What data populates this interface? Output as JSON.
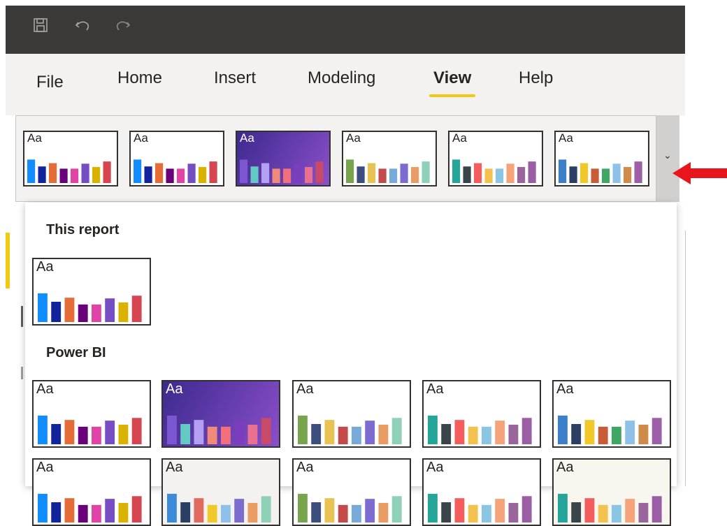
{
  "quick_access": {
    "save_icon": "save-icon",
    "undo_icon": "undo-icon",
    "redo_icon": "redo-icon"
  },
  "tabs": [
    {
      "label": "File",
      "active": false
    },
    {
      "label": "Home",
      "active": false
    },
    {
      "label": "Insert",
      "active": false
    },
    {
      "label": "Modeling",
      "active": false
    },
    {
      "label": "View",
      "active": true
    },
    {
      "label": "Help",
      "active": false
    }
  ],
  "theme_sample_text": "Aa",
  "sections": {
    "this_report": "This report",
    "power_bi": "Power BI"
  },
  "themes": {
    "default": {
      "bg": "#ffffff",
      "bg2": "#ffffff",
      "text": "#252423",
      "bars": [
        "#118dff",
        "#12239e",
        "#e66c37",
        "#6b007b",
        "#e044a7",
        "#744ec2",
        "#d9b300",
        "#d64550"
      ]
    },
    "violet": {
      "bg": "#3c2a8e",
      "bg2": "#8b4fc9",
      "text": "#ffffff",
      "bars": [
        "#7d56d2",
        "#62c9c3",
        "#b3a0f2",
        "#f08a7a",
        "#f2707e",
        "#7a3dbd",
        "#e9708e",
        "#c84a6a"
      ]
    },
    "frontier": {
      "bg": "#ffffff",
      "bg2": "#ffffff",
      "text": "#252423",
      "bars": [
        "#79a44e",
        "#3c4e7d",
        "#e8c354",
        "#c44b4b",
        "#76abd9",
        "#7d6cd0",
        "#e99d64",
        "#8fd0b9"
      ]
    },
    "highrise": {
      "bg": "#ffffff",
      "bg2": "#ffffff",
      "text": "#252423",
      "bars": [
        "#25a49a",
        "#394548",
        "#f45d5d",
        "#f2c14e",
        "#8bc5e4",
        "#f5a37b",
        "#99659c",
        "#9b5ea5"
      ]
    },
    "executive": {
      "bg": "#ffffff",
      "bg2": "#ffffff",
      "text": "#252423",
      "bars": [
        "#3b7fc9",
        "#2b3e63",
        "#f0c82a",
        "#c75c36",
        "#3fa763",
        "#8fc0e8",
        "#d08a4a",
        "#9c5fa8"
      ]
    },
    "tidal": {
      "bg": "#f3f2f1",
      "bg2": "#f3f2f1",
      "text": "#252423",
      "bars": [
        "#3c8bd9",
        "#2b3e63",
        "#e06a5e",
        "#f0c82a",
        "#8fc0e8",
        "#7d6cd0",
        "#e99d64",
        "#8fd0b9"
      ]
    },
    "sunset": {
      "bg": "#f7f6ef",
      "bg2": "#f7f6ef",
      "text": "#252423",
      "bars": [
        "#25a49a",
        "#394548",
        "#f45d5d",
        "#f2c14e",
        "#8bc5e4",
        "#f5a37b",
        "#99659c",
        "#9b5ea5"
      ]
    }
  },
  "strip_themes": [
    "default",
    "default",
    "violet",
    "frontier",
    "highrise",
    "executive"
  ],
  "this_report_themes": [
    "default"
  ],
  "power_bi_themes": [
    "default",
    "violet",
    "frontier",
    "highrise",
    "executive"
  ],
  "power_bi_row2_themes": [
    "default",
    "tidal",
    "frontier",
    "highrise",
    "sunset"
  ],
  "expand_icon": "chevron-down-icon",
  "arrow_color": "#e8151d"
}
